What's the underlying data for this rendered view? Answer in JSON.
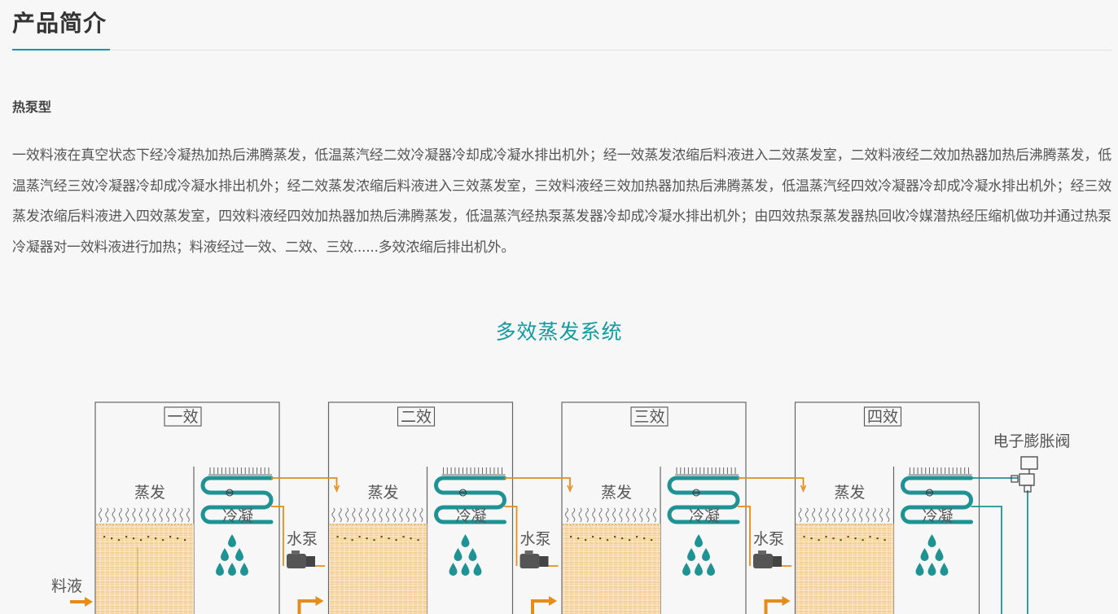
{
  "page": {
    "title": "产品简介",
    "subtitle": "热泵型",
    "paragraph": "一效料液在真空状态下经冷凝热加热后沸腾蒸发，低温蒸汽经二效冷凝器冷却成冷凝水排出机外；经一效蒸发浓缩后料液进入二效蒸发室，二效料液经二效加热器加热后沸腾蒸发，低温蒸汽经三效冷凝器冷却成冷凝水排出机外；经二效蒸发浓缩后料液进入三效蒸发室，三效料液经三效加热器加热后沸腾蒸发，低温蒸汽经四效冷凝器冷却成冷凝水排出机外；经三效蒸发浓缩后料液进入四效蒸发室，四效料液经四效加热器加热后沸腾蒸发，低温蒸汽经热泵蒸发器冷却成冷凝水排出机外；由四效热泵蒸发器热回收冷媒潜热经压缩机做功并通过热泵冷凝器对一效料液进行加热；料液经过一效、二效、三效......多效浓缩后排出机外。"
  },
  "diagram": {
    "title": "多效蒸发系统",
    "stages": [
      {
        "name": "一效",
        "evap_label": "蒸发",
        "cond_label": "冷凝"
      },
      {
        "name": "二效",
        "evap_label": "蒸发",
        "cond_label": "冷凝"
      },
      {
        "name": "三效",
        "evap_label": "蒸发",
        "cond_label": "冷凝"
      },
      {
        "name": "四效",
        "evap_label": "蒸发",
        "cond_label": "冷凝"
      }
    ],
    "pump_label": "水泵",
    "feed_label": "料液",
    "valve_label": "电子膨胀阀",
    "colors": {
      "teal": "#1f9393",
      "orange": "#e58c1b",
      "liquid": "#f2c98a",
      "title": "#139aa0"
    }
  }
}
